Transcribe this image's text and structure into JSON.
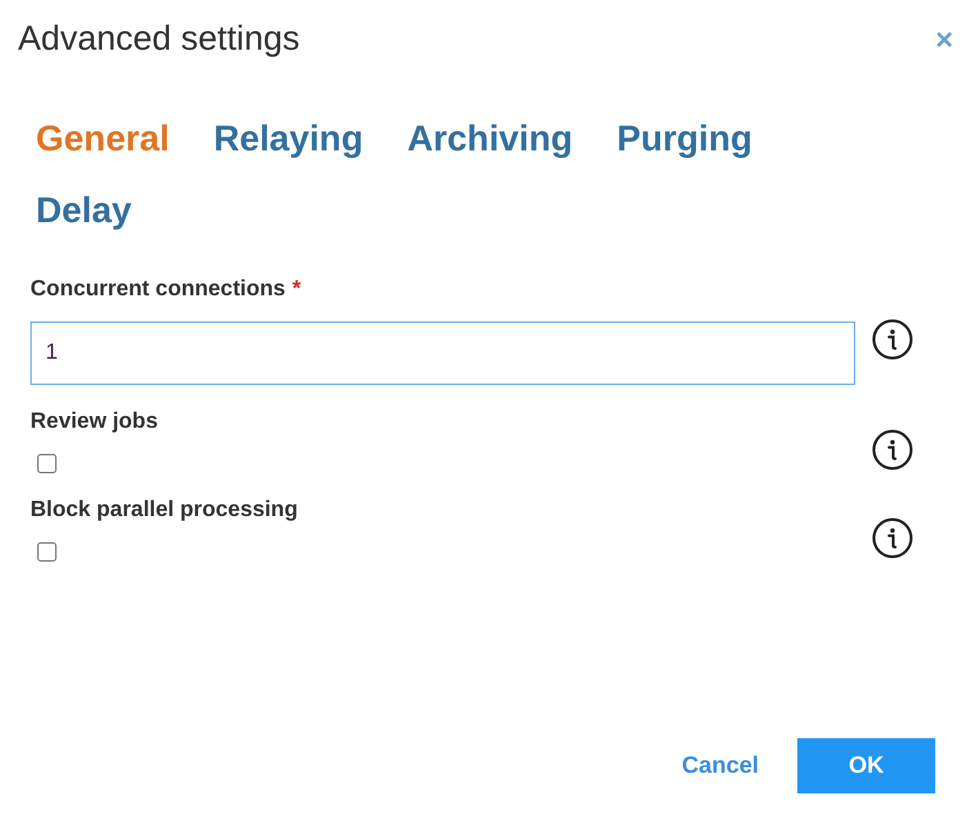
{
  "dialog": {
    "title": "Advanced settings",
    "close": "×"
  },
  "tabs": [
    {
      "label": "General",
      "selected": true
    },
    {
      "label": "Relaying",
      "selected": false
    },
    {
      "label": "Archiving",
      "selected": false
    },
    {
      "label": "Purging",
      "selected": false
    },
    {
      "label": "Delay",
      "selected": false
    }
  ],
  "fields": [
    {
      "kind": "text",
      "label": "Concurrent connections",
      "required_mark": "*",
      "value": "1"
    },
    {
      "kind": "checkbox",
      "label": "Review jobs",
      "checked": false
    },
    {
      "kind": "checkbox",
      "label": "Block parallel processing",
      "checked": false
    }
  ],
  "buttons": [
    {
      "kind": "link",
      "label": "Cancel"
    },
    {
      "kind": "primary",
      "label": "OK"
    }
  ]
}
